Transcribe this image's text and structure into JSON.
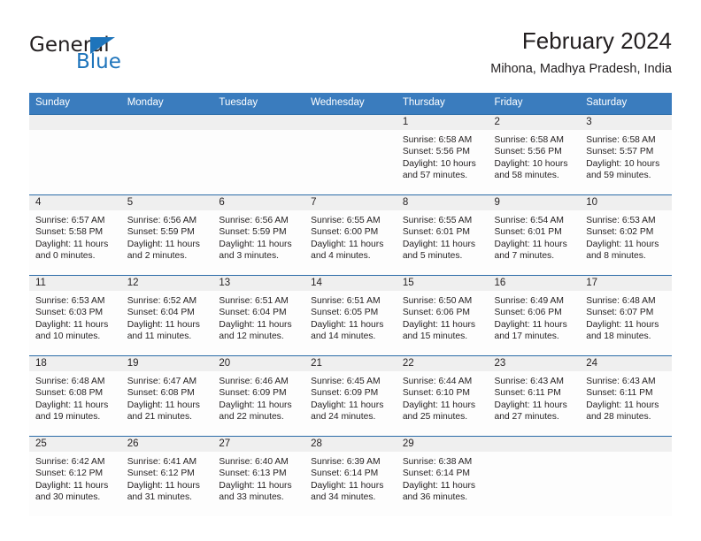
{
  "logo": {
    "word_top": "General",
    "word_bottom": "Blue",
    "accent_color": "#1e74bb"
  },
  "header": {
    "title": "February 2024",
    "subtitle": "Mihona, Madhya Pradesh, India"
  },
  "theme": {
    "header_row_bg": "#3a7cbe",
    "row_divider": "#2b6ca8",
    "daynum_band": "#efefef",
    "text": "#231f20"
  },
  "weekday_headers": [
    "Sunday",
    "Monday",
    "Tuesday",
    "Wednesday",
    "Thursday",
    "Friday",
    "Saturday"
  ],
  "weeks": [
    [
      {
        "day": "",
        "sunrise": "",
        "sunset": "",
        "daylight_1": "",
        "daylight_2": ""
      },
      {
        "day": "",
        "sunrise": "",
        "sunset": "",
        "daylight_1": "",
        "daylight_2": ""
      },
      {
        "day": "",
        "sunrise": "",
        "sunset": "",
        "daylight_1": "",
        "daylight_2": ""
      },
      {
        "day": "",
        "sunrise": "",
        "sunset": "",
        "daylight_1": "",
        "daylight_2": ""
      },
      {
        "day": "1",
        "sunrise": "Sunrise: 6:58 AM",
        "sunset": "Sunset: 5:56 PM",
        "daylight_1": "Daylight: 10 hours",
        "daylight_2": "and 57 minutes."
      },
      {
        "day": "2",
        "sunrise": "Sunrise: 6:58 AM",
        "sunset": "Sunset: 5:56 PM",
        "daylight_1": "Daylight: 10 hours",
        "daylight_2": "and 58 minutes."
      },
      {
        "day": "3",
        "sunrise": "Sunrise: 6:58 AM",
        "sunset": "Sunset: 5:57 PM",
        "daylight_1": "Daylight: 10 hours",
        "daylight_2": "and 59 minutes."
      }
    ],
    [
      {
        "day": "4",
        "sunrise": "Sunrise: 6:57 AM",
        "sunset": "Sunset: 5:58 PM",
        "daylight_1": "Daylight: 11 hours",
        "daylight_2": "and 0 minutes."
      },
      {
        "day": "5",
        "sunrise": "Sunrise: 6:56 AM",
        "sunset": "Sunset: 5:59 PM",
        "daylight_1": "Daylight: 11 hours",
        "daylight_2": "and 2 minutes."
      },
      {
        "day": "6",
        "sunrise": "Sunrise: 6:56 AM",
        "sunset": "Sunset: 5:59 PM",
        "daylight_1": "Daylight: 11 hours",
        "daylight_2": "and 3 minutes."
      },
      {
        "day": "7",
        "sunrise": "Sunrise: 6:55 AM",
        "sunset": "Sunset: 6:00 PM",
        "daylight_1": "Daylight: 11 hours",
        "daylight_2": "and 4 minutes."
      },
      {
        "day": "8",
        "sunrise": "Sunrise: 6:55 AM",
        "sunset": "Sunset: 6:01 PM",
        "daylight_1": "Daylight: 11 hours",
        "daylight_2": "and 5 minutes."
      },
      {
        "day": "9",
        "sunrise": "Sunrise: 6:54 AM",
        "sunset": "Sunset: 6:01 PM",
        "daylight_1": "Daylight: 11 hours",
        "daylight_2": "and 7 minutes."
      },
      {
        "day": "10",
        "sunrise": "Sunrise: 6:53 AM",
        "sunset": "Sunset: 6:02 PM",
        "daylight_1": "Daylight: 11 hours",
        "daylight_2": "and 8 minutes."
      }
    ],
    [
      {
        "day": "11",
        "sunrise": "Sunrise: 6:53 AM",
        "sunset": "Sunset: 6:03 PM",
        "daylight_1": "Daylight: 11 hours",
        "daylight_2": "and 10 minutes."
      },
      {
        "day": "12",
        "sunrise": "Sunrise: 6:52 AM",
        "sunset": "Sunset: 6:04 PM",
        "daylight_1": "Daylight: 11 hours",
        "daylight_2": "and 11 minutes."
      },
      {
        "day": "13",
        "sunrise": "Sunrise: 6:51 AM",
        "sunset": "Sunset: 6:04 PM",
        "daylight_1": "Daylight: 11 hours",
        "daylight_2": "and 12 minutes."
      },
      {
        "day": "14",
        "sunrise": "Sunrise: 6:51 AM",
        "sunset": "Sunset: 6:05 PM",
        "daylight_1": "Daylight: 11 hours",
        "daylight_2": "and 14 minutes."
      },
      {
        "day": "15",
        "sunrise": "Sunrise: 6:50 AM",
        "sunset": "Sunset: 6:06 PM",
        "daylight_1": "Daylight: 11 hours",
        "daylight_2": "and 15 minutes."
      },
      {
        "day": "16",
        "sunrise": "Sunrise: 6:49 AM",
        "sunset": "Sunset: 6:06 PM",
        "daylight_1": "Daylight: 11 hours",
        "daylight_2": "and 17 minutes."
      },
      {
        "day": "17",
        "sunrise": "Sunrise: 6:48 AM",
        "sunset": "Sunset: 6:07 PM",
        "daylight_1": "Daylight: 11 hours",
        "daylight_2": "and 18 minutes."
      }
    ],
    [
      {
        "day": "18",
        "sunrise": "Sunrise: 6:48 AM",
        "sunset": "Sunset: 6:08 PM",
        "daylight_1": "Daylight: 11 hours",
        "daylight_2": "and 19 minutes."
      },
      {
        "day": "19",
        "sunrise": "Sunrise: 6:47 AM",
        "sunset": "Sunset: 6:08 PM",
        "daylight_1": "Daylight: 11 hours",
        "daylight_2": "and 21 minutes."
      },
      {
        "day": "20",
        "sunrise": "Sunrise: 6:46 AM",
        "sunset": "Sunset: 6:09 PM",
        "daylight_1": "Daylight: 11 hours",
        "daylight_2": "and 22 minutes."
      },
      {
        "day": "21",
        "sunrise": "Sunrise: 6:45 AM",
        "sunset": "Sunset: 6:09 PM",
        "daylight_1": "Daylight: 11 hours",
        "daylight_2": "and 24 minutes."
      },
      {
        "day": "22",
        "sunrise": "Sunrise: 6:44 AM",
        "sunset": "Sunset: 6:10 PM",
        "daylight_1": "Daylight: 11 hours",
        "daylight_2": "and 25 minutes."
      },
      {
        "day": "23",
        "sunrise": "Sunrise: 6:43 AM",
        "sunset": "Sunset: 6:11 PM",
        "daylight_1": "Daylight: 11 hours",
        "daylight_2": "and 27 minutes."
      },
      {
        "day": "24",
        "sunrise": "Sunrise: 6:43 AM",
        "sunset": "Sunset: 6:11 PM",
        "daylight_1": "Daylight: 11 hours",
        "daylight_2": "and 28 minutes."
      }
    ],
    [
      {
        "day": "25",
        "sunrise": "Sunrise: 6:42 AM",
        "sunset": "Sunset: 6:12 PM",
        "daylight_1": "Daylight: 11 hours",
        "daylight_2": "and 30 minutes."
      },
      {
        "day": "26",
        "sunrise": "Sunrise: 6:41 AM",
        "sunset": "Sunset: 6:12 PM",
        "daylight_1": "Daylight: 11 hours",
        "daylight_2": "and 31 minutes."
      },
      {
        "day": "27",
        "sunrise": "Sunrise: 6:40 AM",
        "sunset": "Sunset: 6:13 PM",
        "daylight_1": "Daylight: 11 hours",
        "daylight_2": "and 33 minutes."
      },
      {
        "day": "28",
        "sunrise": "Sunrise: 6:39 AM",
        "sunset": "Sunset: 6:14 PM",
        "daylight_1": "Daylight: 11 hours",
        "daylight_2": "and 34 minutes."
      },
      {
        "day": "29",
        "sunrise": "Sunrise: 6:38 AM",
        "sunset": "Sunset: 6:14 PM",
        "daylight_1": "Daylight: 11 hours",
        "daylight_2": "and 36 minutes."
      },
      {
        "day": "",
        "sunrise": "",
        "sunset": "",
        "daylight_1": "",
        "daylight_2": ""
      },
      {
        "day": "",
        "sunrise": "",
        "sunset": "",
        "daylight_1": "",
        "daylight_2": ""
      }
    ]
  ]
}
